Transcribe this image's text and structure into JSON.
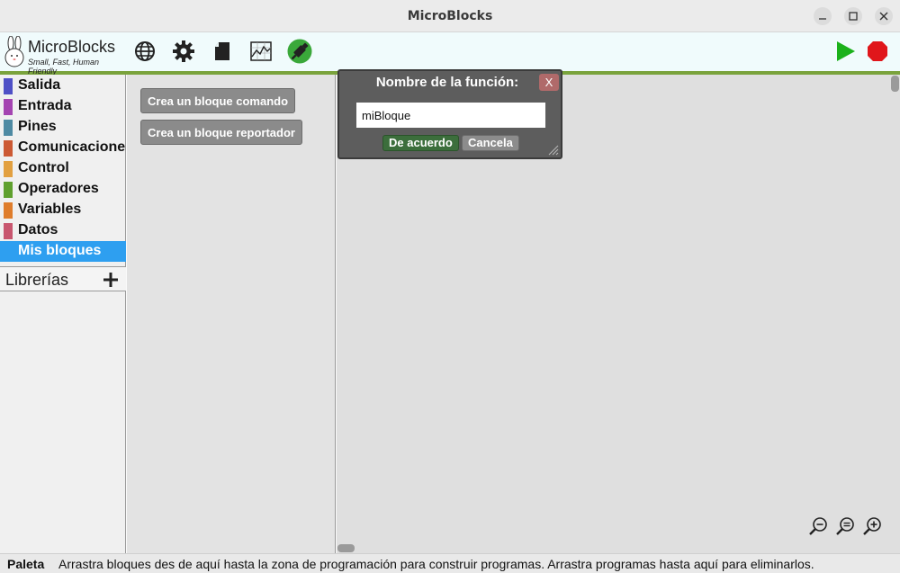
{
  "window": {
    "title": "MicroBlocks",
    "minimize_icon": "minimize-icon",
    "maximize_icon": "maximize-icon",
    "close_icon": "close-icon"
  },
  "brand": {
    "name": "MicroBlocks",
    "tagline": "Small, Fast, Human Friendly",
    "icon": "bunny-logo"
  },
  "toolbar": {
    "left_icons": [
      "globe-icon",
      "gear-icon",
      "file-icon",
      "graph-icon",
      "usb-connected-icon"
    ],
    "right_icons": [
      "start-icon",
      "stop-icon"
    ],
    "connected_color": "#3aa83a",
    "start_color": "#1bb11b",
    "stop_color": "#e0161b",
    "accent_color": "#7aa33c"
  },
  "sidebar": {
    "categories": [
      {
        "label": "Salida",
        "color": "#4f50c6"
      },
      {
        "label": "Entrada",
        "color": "#a444b1"
      },
      {
        "label": "Pines",
        "color": "#4e8aa3"
      },
      {
        "label": "Comunicaciones",
        "color": "#cc5a34"
      },
      {
        "label": "Control",
        "color": "#e2a040"
      },
      {
        "label": "Operadores",
        "color": "#5fa02e"
      },
      {
        "label": "Variables",
        "color": "#df7d2c"
      },
      {
        "label": "Datos",
        "color": "#c8566f"
      },
      {
        "label": "Mis bloques",
        "color": "#2e9ff0",
        "selected": true
      }
    ],
    "libraries_label": "Librerías",
    "libraries_add_icon": "plus-icon"
  },
  "palette": {
    "buttons": [
      "Crea un bloque comando",
      "Crea un bloque reportador"
    ]
  },
  "dialog": {
    "title": "Nombre de la función:",
    "close_label": "X",
    "input_value": "miBloque",
    "ok_label": "De acuerdo",
    "cancel_label": "Cancela"
  },
  "zoom": {
    "icons": [
      "zoom-out-icon",
      "zoom-reset-icon",
      "zoom-in-icon"
    ]
  },
  "status": {
    "heading": "Paleta",
    "message": "Arrastra bloques des de aquí hasta la zona de programación para construir programas. Arrastra programas hasta aquí para eliminarlos."
  }
}
